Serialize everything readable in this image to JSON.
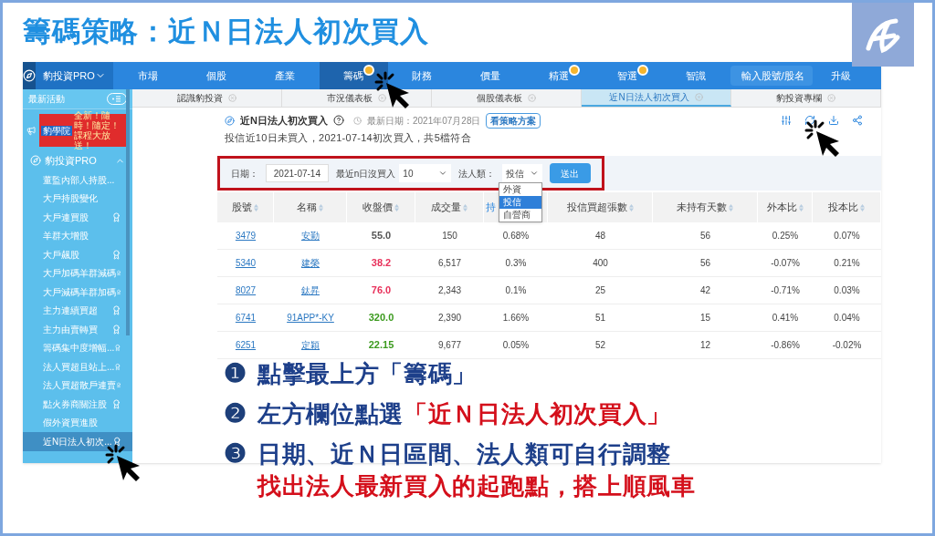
{
  "slide_title": "籌碼策略：近Ｎ日法人初次買入",
  "app": {
    "product": "豹投資PRO",
    "nav": [
      {
        "label": "市場",
        "selected": false,
        "dot": false
      },
      {
        "label": "個股",
        "selected": false,
        "dot": false
      },
      {
        "label": "產業",
        "selected": false,
        "dot": false
      },
      {
        "label": "籌碼",
        "selected": true,
        "dot": true
      },
      {
        "label": "財務",
        "selected": false,
        "dot": false
      },
      {
        "label": "價量",
        "selected": false,
        "dot": false
      },
      {
        "label": "精選",
        "selected": false,
        "dot": true
      },
      {
        "label": "智選",
        "selected": false,
        "dot": true
      },
      {
        "label": "智識",
        "selected": false,
        "dot": false
      }
    ],
    "search": {
      "placeholder": "輸入股號/股名"
    },
    "upgrade": "升級",
    "page_tabs": [
      {
        "label": "認識豹投資",
        "selected": false
      },
      {
        "label": "市況儀表板",
        "selected": false
      },
      {
        "label": "個股儀表板",
        "selected": false
      },
      {
        "label": "近N日法人初次買入",
        "selected": true
      },
      {
        "label": "豹投資專欄",
        "selected": false
      }
    ],
    "sidebar": {
      "news": "最新活動",
      "banner": {
        "brand": "豹學院",
        "text": "全新！隨時！隨定！課程大放送！"
      },
      "section": {
        "label": "豹投資PRO",
        "expanded": true,
        "items": [
          {
            "label": "董監內部人持股...",
            "award": false,
            "selected": false
          },
          {
            "label": "大戶持股變化",
            "award": false,
            "selected": false
          },
          {
            "label": "大戶連買股",
            "award": true,
            "selected": false
          },
          {
            "label": "羊群大增股",
            "award": false,
            "selected": false
          },
          {
            "label": "大戶飆股",
            "award": true,
            "selected": false
          },
          {
            "label": "大戶加碼羊群減碼",
            "award": true,
            "selected": false
          },
          {
            "label": "大戶減碼羊群加碼",
            "award": true,
            "selected": false
          },
          {
            "label": "主力連續買超",
            "award": true,
            "selected": false
          },
          {
            "label": "主力由賣轉買",
            "award": true,
            "selected": false
          },
          {
            "label": "籌碼集中度增幅...",
            "award": true,
            "selected": false
          },
          {
            "label": "法人買超且站上...",
            "award": true,
            "selected": false
          },
          {
            "label": "法人買超散戶連賣",
            "award": true,
            "selected": false
          },
          {
            "label": "點火券商關注股",
            "award": true,
            "selected": false
          },
          {
            "label": "假外資買進股",
            "award": false,
            "selected": false
          },
          {
            "label": "近N日法人初次...",
            "award": true,
            "selected": true
          }
        ]
      }
    }
  },
  "strategy": {
    "title": "近N日法人初次買入",
    "updated": "最新日期：2021年07月28日",
    "plan_button": "看策略方案",
    "summary": "投信近10日未買入，2021-07-14初次買入，共5檔符合",
    "filters": {
      "date_label": "日期：",
      "date": "2021-07-14",
      "days_label": "最近n日沒買入",
      "days": "10",
      "type_label": "法人類：",
      "type": "投信",
      "type_options": [
        {
          "label": "外資",
          "selected": false
        },
        {
          "label": "投信",
          "selected": true
        },
        {
          "label": "自營商",
          "selected": false
        }
      ],
      "submit": "送出"
    },
    "table": {
      "columns": [
        "股號",
        "名稱",
        "收盤價",
        "成交量",
        "持",
        "投信買超張數",
        "未持有天數",
        "外本比",
        "投本比"
      ],
      "rows": [
        {
          "cells": [
            "3479",
            "安勤",
            "55.0",
            "150",
            "0.68%",
            "48",
            "56",
            "0.25%",
            "0.07%"
          ],
          "color": "#555555"
        },
        {
          "cells": [
            "5340",
            "建榮",
            "38.2",
            "6,517",
            "0.3%",
            "400",
            "56",
            "-0.07%",
            "0.21%"
          ],
          "color": "#e8305a"
        },
        {
          "cells": [
            "8027",
            "鈦昇",
            "76.0",
            "2,343",
            "0.1%",
            "25",
            "42",
            "-0.71%",
            "0.03%"
          ],
          "color": "#e8305a"
        },
        {
          "cells": [
            "6741",
            "91APP*-KY",
            "320.0",
            "2,390",
            "1.66%",
            "51",
            "15",
            "0.41%",
            "0.04%"
          ],
          "color": "#3b9a1e"
        },
        {
          "cells": [
            "6251",
            "定穎",
            "22.15",
            "9,677",
            "0.05%",
            "52",
            "12",
            "-0.86%",
            "-0.02%"
          ],
          "color": "#3b9a1e"
        }
      ]
    }
  },
  "steps": [
    {
      "number": "❶",
      "parts": [
        {
          "text": "點擊最上方「籌碼」",
          "highlight": false
        }
      ]
    },
    {
      "number": "❷",
      "parts": [
        {
          "text": "左方欄位點選",
          "highlight": false
        },
        {
          "text": "「近Ｎ日法人初次買入」",
          "highlight": true
        }
      ]
    },
    {
      "number": "❸",
      "parts": [
        {
          "text": "日期、近Ｎ日區間、法人類可自行調整",
          "highlight": false
        }
      ],
      "note": "找出法人最新買入的起跑點，搭上順風車"
    }
  ]
}
